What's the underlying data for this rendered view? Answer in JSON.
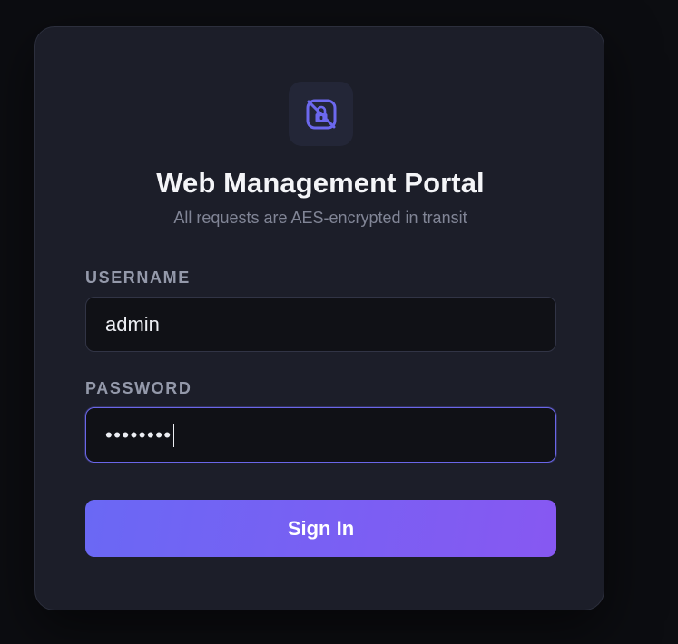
{
  "portal": {
    "title": "Web Management Portal",
    "subtitle": "All requests are AES-encrypted in transit",
    "logo_icon": "lock-shield-icon"
  },
  "form": {
    "username": {
      "label": "USERNAME",
      "value": "admin"
    },
    "password": {
      "label": "PASSWORD",
      "masked_value": "••••••••"
    },
    "submit_label": "Sign In"
  },
  "colors": {
    "accent": "#6a66e8",
    "button_gradient_start": "#6a68f4",
    "button_gradient_end": "#8758f2",
    "card_background": "#1c1e29",
    "page_background": "#0c0d11"
  }
}
